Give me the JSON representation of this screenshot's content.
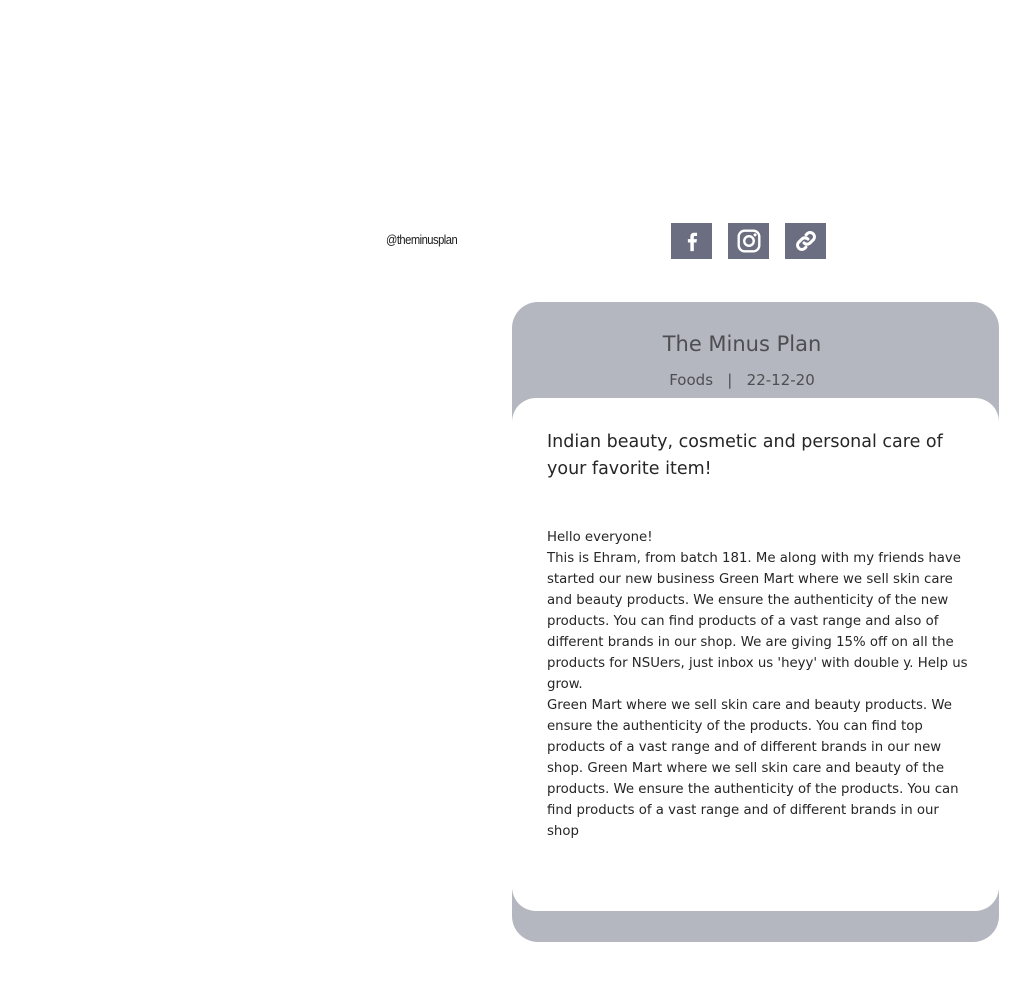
{
  "profile": {
    "handle": "@theminusplan"
  },
  "socials": [
    {
      "icon": "facebook-icon",
      "label": "Facebook"
    },
    {
      "icon": "instagram-icon",
      "label": "Instagram"
    },
    {
      "icon": "link-icon",
      "label": "Link"
    }
  ],
  "colors": {
    "social_bg": "#6b6d80",
    "card_bg": "#b4b7bf",
    "card_body_bg": "#ffffff",
    "title_text": "#4e4e52",
    "body_text": "#262626"
  },
  "card": {
    "title": "The Minus Plan",
    "meta": "Foods   |   22-12-20",
    "headline": "Indian beauty, cosmetic and personal care of your favorite item!",
    "greeting": "Hello everyone!",
    "paragraph_1": "This is Ehram, from batch 181. Me along with my friends have started our new business Green Mart where we sell skin care and beauty products. We ensure the authenticity of the new products. You can find products of a vast range and also of different brands in our shop. We are giving 15% off on all the products for NSUers, just inbox us 'heyy' with double y. Help us grow.",
    "paragraph_2": "Green Mart where we sell skin care and beauty products. We ensure the authenticity of the products. You can find top products of a vast range and of different brands in our new shop. Green Mart where we sell skin care and beauty of the products. We ensure the authenticity of the products. You can find products of a vast range and of different brands in our shop"
  }
}
